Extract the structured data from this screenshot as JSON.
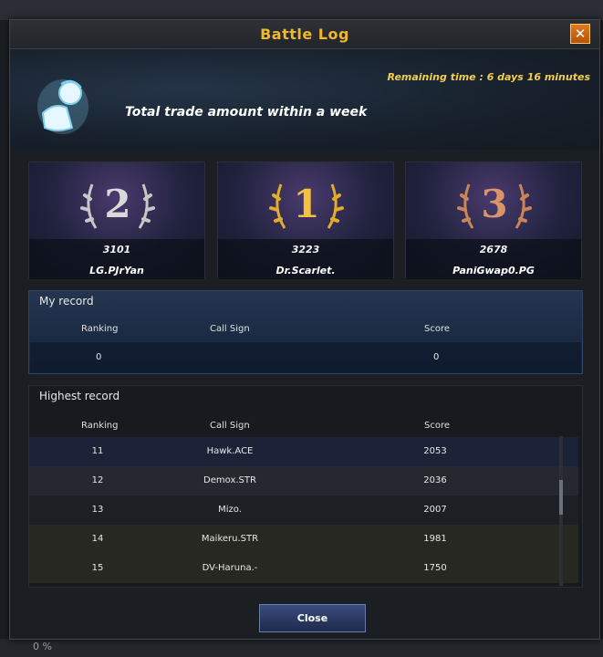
{
  "background": {
    "progress_text": "0 %"
  },
  "window": {
    "title": "Battle Log",
    "close_icon": "✕"
  },
  "hero": {
    "remaining_time": "Remaining time : 6 days 16 minutes",
    "heading": "Total trade amount within a week"
  },
  "podium": [
    {
      "rank": "2",
      "score": "3101",
      "name": "LG.PJrYan",
      "medal_color": "#c7c7c7"
    },
    {
      "rank": "1",
      "score": "3223",
      "name": "Dr.Scarlet.",
      "medal_color": "#e0ad2c"
    },
    {
      "rank": "3",
      "score": "2678",
      "name": "PaniGwap0.PG",
      "medal_color": "#c9845a"
    }
  ],
  "my_record": {
    "title": "My record",
    "columns": [
      "Ranking",
      "Call Sign",
      "Score"
    ],
    "row": {
      "ranking": "0",
      "call_sign": "",
      "score": "0"
    }
  },
  "highest_record": {
    "title": "Highest record",
    "columns": [
      "Ranking",
      "Call Sign",
      "Score"
    ],
    "rows": [
      {
        "ranking": "11",
        "call_sign": "Hawk.ACE",
        "score": "2053"
      },
      {
        "ranking": "12",
        "call_sign": "Demox.STR",
        "score": "2036"
      },
      {
        "ranking": "13",
        "call_sign": "Mizo.",
        "score": "2007"
      },
      {
        "ranking": "14",
        "call_sign": "Maikeru.STR",
        "score": "1981"
      },
      {
        "ranking": "15",
        "call_sign": "DV-Haruna.-",
        "score": "1750"
      }
    ]
  },
  "footer": {
    "close_label": "Close"
  },
  "colors": {
    "accent_gold": "#f0b82c",
    "button_blue": "#2b3a66"
  }
}
